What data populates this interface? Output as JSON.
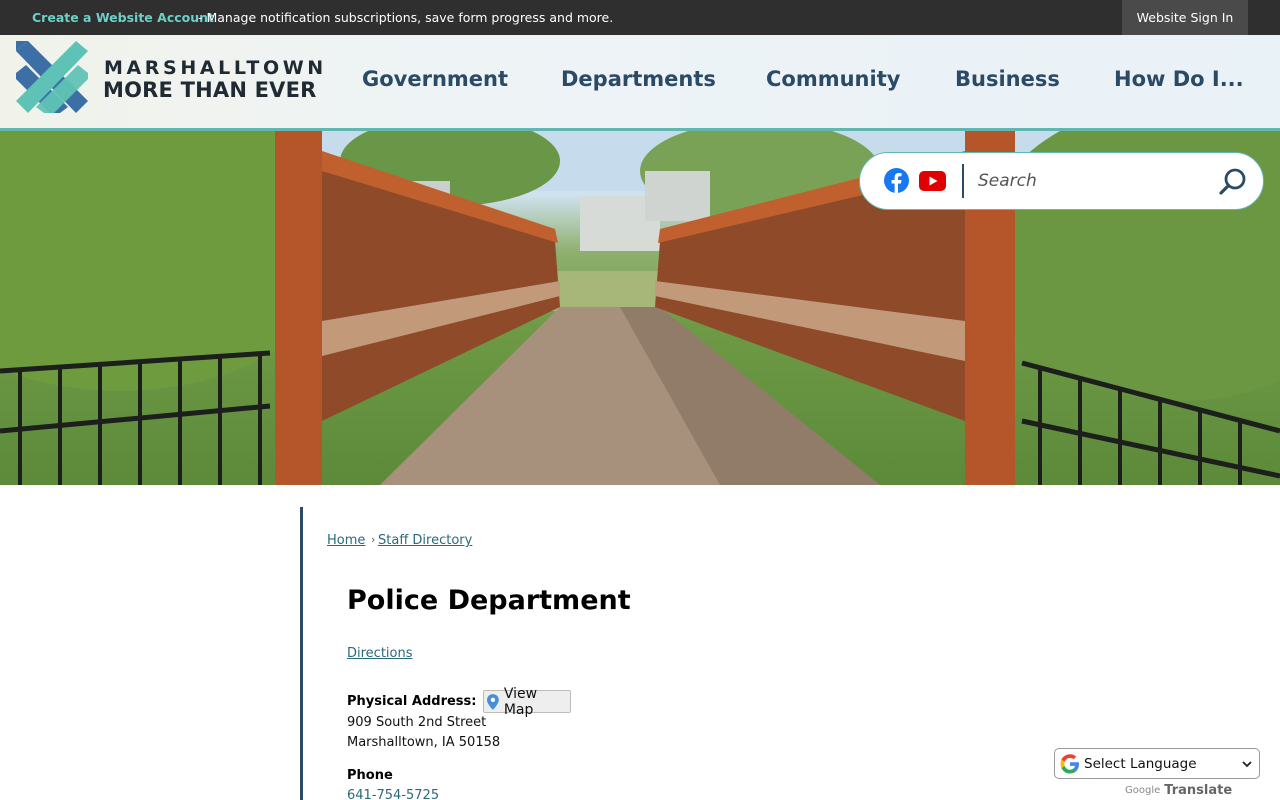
{
  "topbar": {
    "create_account": "Create a Website Account",
    "description": "- Manage notification subscriptions, save form progress and more.",
    "sign_in": "Website Sign In"
  },
  "logo": {
    "line1": "MARSHALLTOWN",
    "line2": "MORE THAN EVER",
    "colors": {
      "blue": "#3b6fa5",
      "teal": "#5fc2b6"
    }
  },
  "nav": {
    "items": [
      "Government",
      "Departments",
      "Community",
      "Business",
      "How Do I..."
    ]
  },
  "search": {
    "placeholder": "Search",
    "social": [
      "facebook-icon",
      "youtube-icon"
    ]
  },
  "breadcrumb": {
    "home": "Home",
    "separator": "›",
    "current": "Staff Directory"
  },
  "department": {
    "title": "Police Department",
    "directions_link": "Directions",
    "physical_address_label": "Physical Address:",
    "view_map": "View Map",
    "address_line1": "909 South 2nd Street",
    "address_line2": "Marshalltown, IA 50158",
    "phone_label": "Phone",
    "phone": "641-754-5725"
  },
  "translate": {
    "select_label": "Select Language",
    "powered_google": "Google",
    "powered_translate": "Translate"
  },
  "colors": {
    "accent_teal": "#5fb7b0",
    "nav_blue": "#2a4a66",
    "link": "#2a6a7a",
    "topbar_bg": "#2f2f2f"
  }
}
